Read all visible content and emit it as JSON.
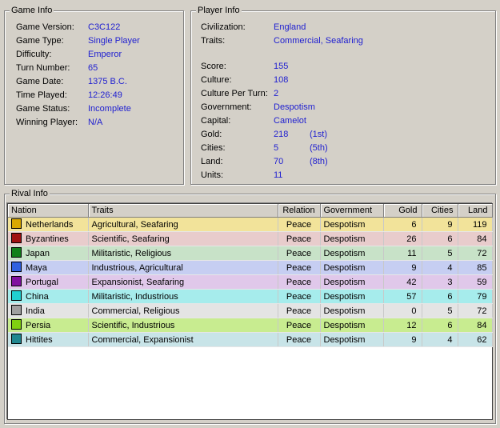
{
  "game_info": {
    "title": "Game Info",
    "rows": [
      {
        "label": "Game Version:",
        "value": "C3C122"
      },
      {
        "label": "Game Type:",
        "value": "Single Player"
      },
      {
        "label": "Difficulty:",
        "value": "Emperor"
      },
      {
        "label": "Turn Number:",
        "value": "65"
      },
      {
        "label": "Game Date:",
        "value": "1375 B.C."
      },
      {
        "label": "Time Played:",
        "value": "12:26:49"
      },
      {
        "label": "Game Status:",
        "value": "Incomplete"
      },
      {
        "label": "Winning Player:",
        "value": "N/A"
      }
    ]
  },
  "player_info": {
    "title": "Player Info",
    "civilization_label": "Civilization:",
    "civilization": "England",
    "traits_label": "Traits:",
    "traits": "Commercial, Seafaring",
    "rows": [
      {
        "label": "Score:",
        "value": "155",
        "rank": ""
      },
      {
        "label": "Culture:",
        "value": "108",
        "rank": ""
      },
      {
        "label": "Culture Per Turn:",
        "value": "2",
        "rank": ""
      },
      {
        "label": "Government:",
        "value": "Despotism",
        "rank": ""
      },
      {
        "label": "Capital:",
        "value": "Camelot",
        "rank": ""
      },
      {
        "label": "Gold:",
        "value": "218",
        "rank": "(1st)"
      },
      {
        "label": "Cities:",
        "value": "5",
        "rank": "(5th)"
      },
      {
        "label": "Land:",
        "value": "70",
        "rank": "(8th)"
      },
      {
        "label": "Units:",
        "value": "11",
        "rank": ""
      }
    ]
  },
  "rival_info": {
    "title": "Rival Info",
    "columns": [
      "Nation",
      "Traits",
      "Relation",
      "Government",
      "Gold",
      "Cities",
      "Land"
    ],
    "rows": [
      {
        "nation": "Netherlands",
        "swatch": "#d9a800",
        "bg": "#f2e39a",
        "traits": "Agricultural, Seafaring",
        "relation": "Peace",
        "government": "Despotism",
        "gold": "6",
        "cities": "9",
        "land": "119"
      },
      {
        "nation": "Byzantines",
        "swatch": "#a01010",
        "bg": "#e8cccc",
        "traits": "Scientific, Seafaring",
        "relation": "Peace",
        "government": "Despotism",
        "gold": "26",
        "cities": "6",
        "land": "84"
      },
      {
        "nation": "Japan",
        "swatch": "#10801a",
        "bg": "#c8e2c8",
        "traits": "Militaristic, Religious",
        "relation": "Peace",
        "government": "Despotism",
        "gold": "11",
        "cities": "5",
        "land": "72"
      },
      {
        "nation": "Maya",
        "swatch": "#3060e0",
        "bg": "#c6cef2",
        "traits": "Industrious, Agricultural",
        "relation": "Peace",
        "government": "Despotism",
        "gold": "9",
        "cities": "4",
        "land": "85"
      },
      {
        "nation": "Portugal",
        "swatch": "#8010a0",
        "bg": "#e0c8ea",
        "traits": "Expansionist, Seafaring",
        "relation": "Peace",
        "government": "Despotism",
        "gold": "42",
        "cities": "3",
        "land": "59"
      },
      {
        "nation": "China",
        "swatch": "#20d0d0",
        "bg": "#a6ecec",
        "traits": "Militaristic, Industrious",
        "relation": "Peace",
        "government": "Despotism",
        "gold": "57",
        "cities": "6",
        "land": "79"
      },
      {
        "nation": "India",
        "swatch": "#a0a0a0",
        "bg": "#e4e4e4",
        "traits": "Commercial, Religious",
        "relation": "Peace",
        "government": "Despotism",
        "gold": "0",
        "cities": "5",
        "land": "72"
      },
      {
        "nation": "Persia",
        "swatch": "#80d010",
        "bg": "#c8ec90",
        "traits": "Scientific, Industrious",
        "relation": "Peace",
        "government": "Despotism",
        "gold": "12",
        "cities": "6",
        "land": "84"
      },
      {
        "nation": "Hittites",
        "swatch": "#208890",
        "bg": "#c8e4e8",
        "traits": "Commercial, Expansionist",
        "relation": "Peace",
        "government": "Despotism",
        "gold": "9",
        "cities": "4",
        "land": "62"
      }
    ]
  }
}
